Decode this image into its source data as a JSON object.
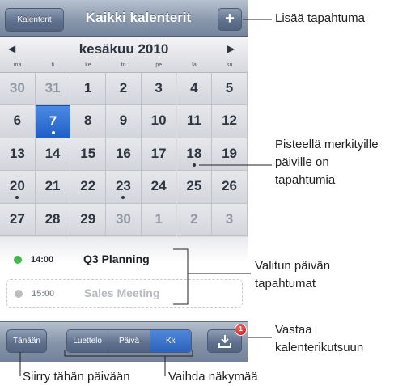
{
  "navbar": {
    "calendars_button": "Kalenterit",
    "title": "Kaikki kalenterit",
    "add_button": "+"
  },
  "month_header": {
    "prev_icon": "◀",
    "title": "kesäkuu 2010",
    "next_icon": "▶",
    "weekdays": [
      "ma",
      "ti",
      "ke",
      "to",
      "pe",
      "la",
      "su"
    ]
  },
  "calendar": {
    "selected_day": "7",
    "weeks": [
      [
        {
          "d": "30",
          "other": true
        },
        {
          "d": "31",
          "other": true
        },
        {
          "d": "1"
        },
        {
          "d": "2"
        },
        {
          "d": "3"
        },
        {
          "d": "4"
        },
        {
          "d": "5"
        }
      ],
      [
        {
          "d": "6"
        },
        {
          "d": "7",
          "selected": true,
          "dot": true
        },
        {
          "d": "8"
        },
        {
          "d": "9"
        },
        {
          "d": "10"
        },
        {
          "d": "11"
        },
        {
          "d": "12"
        }
      ],
      [
        {
          "d": "13"
        },
        {
          "d": "14"
        },
        {
          "d": "15"
        },
        {
          "d": "16"
        },
        {
          "d": "17"
        },
        {
          "d": "18",
          "dot": true
        },
        {
          "d": "19"
        }
      ],
      [
        {
          "d": "20",
          "dot": true
        },
        {
          "d": "21"
        },
        {
          "d": "22"
        },
        {
          "d": "23",
          "dot": true
        },
        {
          "d": "24"
        },
        {
          "d": "25"
        },
        {
          "d": "26"
        }
      ],
      [
        {
          "d": "27"
        },
        {
          "d": "28"
        },
        {
          "d": "29"
        },
        {
          "d": "30",
          "other": true
        },
        {
          "d": "1",
          "other": true
        },
        {
          "d": "2",
          "other": true
        },
        {
          "d": "3",
          "other": true
        }
      ]
    ]
  },
  "events": [
    {
      "time": "14:00",
      "title": "Q3 Planning",
      "color": "#3fb949"
    },
    {
      "time": "15:00",
      "title": "Sales Meeting",
      "color": "#bdbdbd"
    }
  ],
  "toolbar": {
    "today_button": "Tänään",
    "views": [
      {
        "label": "Luettelo",
        "active": false
      },
      {
        "label": "Päivä",
        "active": false
      },
      {
        "label": "Kk",
        "active": true
      }
    ],
    "invite_icon": "inbox-download-icon",
    "invite_badge": "1"
  },
  "callouts": {
    "add_event": "Lisää tapahtuma",
    "dot_days": "Pisteellä merkityille päiville on tapahtumia",
    "selected_events": "Valitun päivän tapahtumat",
    "respond_invite": "Vastaa kalenterikutsuun",
    "go_today": "Siirry tähän päivään",
    "switch_view": "Vaihda näkymää"
  },
  "colors": {
    "selected_day": "#2c6fd6",
    "accent_bar": "#7f8ea6"
  }
}
